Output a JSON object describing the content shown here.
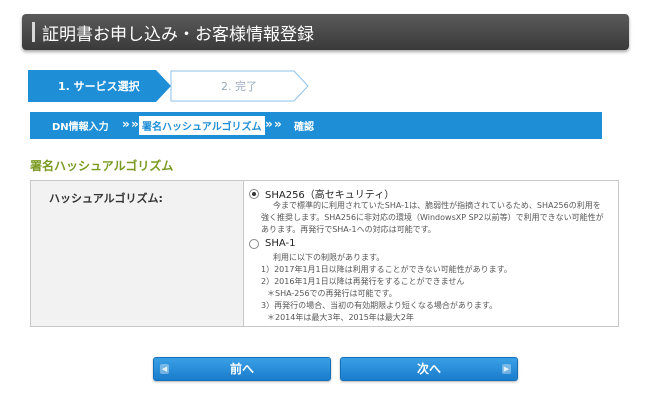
{
  "header": {
    "title": "証明書お申し込み・お客様情報登録"
  },
  "steps": [
    {
      "label": "1. サービス選択",
      "active": true
    },
    {
      "label": "2. 完了",
      "active": false
    }
  ],
  "subnav": {
    "items": [
      "DN情報入力",
      "署名ハッシュアルゴリズム",
      "確認"
    ],
    "separator": "»",
    "active_index": 1
  },
  "section": {
    "heading": "署名ハッシュアルゴリズム"
  },
  "form": {
    "label": "ハッシュアルゴリズム:",
    "options": [
      {
        "label": "SHA256（高セキュリティ）",
        "checked": true,
        "description": [
          "今まで標準的に利用されていたSHA-1は、脆弱性が指摘されているため、SHA256の利用を",
          "強く推奨します。SHA256に非対応の環境（WindowsXP SP2以前等）で利用できない可能性が",
          "あります。再発行でSHA-1への対応は可能です。"
        ]
      },
      {
        "label": "SHA-1",
        "checked": false,
        "description": [
          "利用に以下の制限があります。",
          "1）2017年1月1日以降は利用することができない可能性があります。",
          "2）2016年1月1日以降は再発行をすることができません",
          "＊SHA-256での再発行は可能です。",
          "3）再発行の場合、当初の有効期限より短くなる場合があります。",
          "＊2014年は最大3年、2015年は最大2年"
        ]
      }
    ]
  },
  "buttons": {
    "prev": "前へ",
    "next": "次へ"
  },
  "colors": {
    "accent_blue": "#1e8fd6",
    "heading_green": "#7a9a22",
    "title_bar": "#444444"
  }
}
